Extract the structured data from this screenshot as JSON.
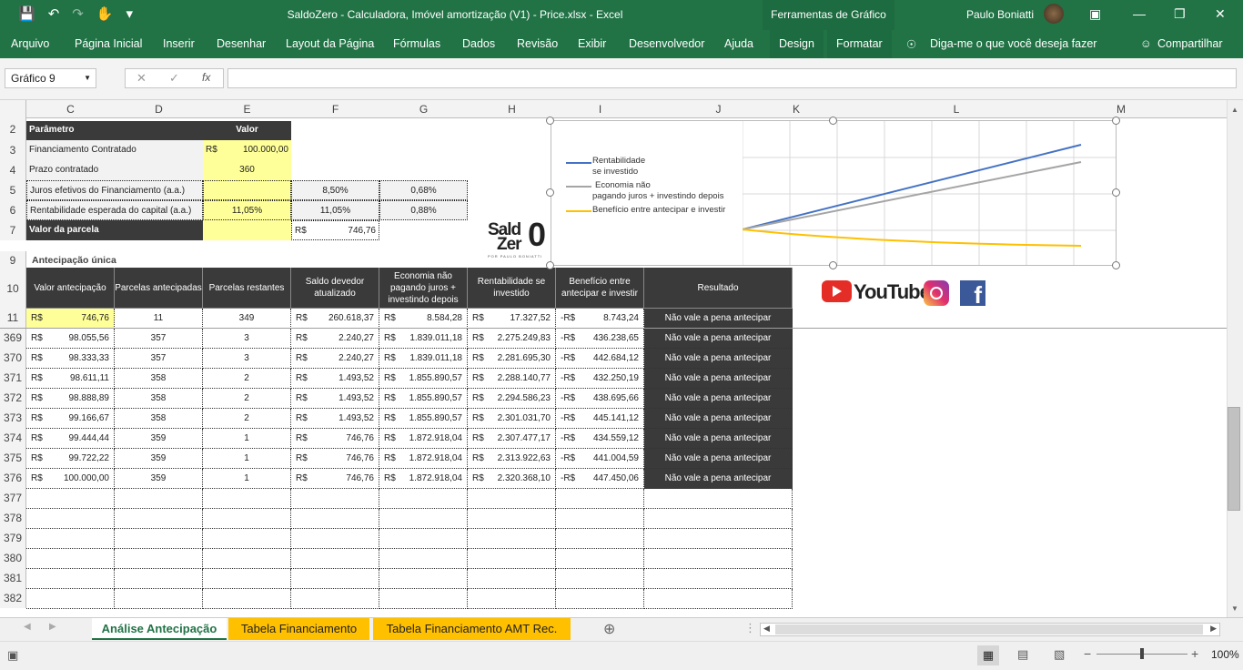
{
  "window": {
    "title": "SaldoZero - Calculadora, Imóvel amortização (V1) - Price.xlsx  -  Excel",
    "context_tab": "Ferramentas de Gráfico",
    "user": "Paulo Boniatti"
  },
  "ribbon": {
    "tabs": [
      "Arquivo",
      "Página Inicial",
      "Inserir",
      "Desenhar",
      "Layout da Página",
      "Fórmulas",
      "Dados",
      "Revisão",
      "Exibir",
      "Desenvolvedor",
      "Ajuda",
      "Design",
      "Formatar"
    ],
    "tell_me": "Diga-me o que você deseja fazer",
    "share": "Compartilhar"
  },
  "formula_bar": {
    "name_box": "Gráfico 9",
    "fx": "fx",
    "value": ""
  },
  "columns": [
    "C",
    "D",
    "E",
    "F",
    "G",
    "H",
    "I",
    "J",
    "K",
    "L",
    "M"
  ],
  "rows": [
    "2",
    "3",
    "4",
    "5",
    "6",
    "7",
    "9",
    "10",
    "11",
    "369",
    "370",
    "371",
    "372",
    "373",
    "374",
    "375",
    "376",
    "377",
    "378",
    "379",
    "380",
    "381",
    "382"
  ],
  "params": {
    "header_param": "Parâmetro",
    "header_value": "Valor",
    "r3_label": "Financiamento Contratado",
    "r3_cur": "R$",
    "r3_val": "100.000,00",
    "r4_label": "Prazo contratado",
    "r4_val": "360",
    "r5_label": "Juros efetivos do Financiamento (a.a.)",
    "r5_f": "8,50%",
    "r5_g": "0,68%",
    "r6_label": "Rentabilidade esperada do capital (a.a.)",
    "r6_e": "11,05%",
    "r6_f": "11,05%",
    "r6_g": "0,88%",
    "r7_label": "Valor da parcela",
    "r7_cur": "R$",
    "r7_val": "746,76"
  },
  "section_title": "Antecipação única",
  "table": {
    "headers": [
      "Valor antecipação",
      "Parcelas antecipadas",
      "Parcelas restantes",
      "Saldo devedor atualizado",
      "Economia não pagando juros + investindo depois",
      "Rentabilidade se investido",
      "Benefício entre antecipar e investir",
      "Resultado"
    ],
    "rows": [
      [
        "R$",
        "746,76",
        "11",
        "349",
        "R$",
        "260.618,37",
        "R$",
        "8.584,28",
        "R$",
        "17.327,52",
        "-R$",
        "8.743,24",
        "Não vale a pena antecipar"
      ],
      [
        "R$",
        "98.055,56",
        "357",
        "3",
        "R$",
        "2.240,27",
        "R$",
        "1.839.011,18",
        "R$",
        "2.275.249,83",
        "-R$",
        "436.238,65",
        "Não vale a pena antecipar"
      ],
      [
        "R$",
        "98.333,33",
        "357",
        "3",
        "R$",
        "2.240,27",
        "R$",
        "1.839.011,18",
        "R$",
        "2.281.695,30",
        "-R$",
        "442.684,12",
        "Não vale a pena antecipar"
      ],
      [
        "R$",
        "98.611,11",
        "358",
        "2",
        "R$",
        "1.493,52",
        "R$",
        "1.855.890,57",
        "R$",
        "2.288.140,77",
        "-R$",
        "432.250,19",
        "Não vale a pena antecipar"
      ],
      [
        "R$",
        "98.888,89",
        "358",
        "2",
        "R$",
        "1.493,52",
        "R$",
        "1.855.890,57",
        "R$",
        "2.294.586,23",
        "-R$",
        "438.695,66",
        "Não vale a pena antecipar"
      ],
      [
        "R$",
        "99.166,67",
        "358",
        "2",
        "R$",
        "1.493,52",
        "R$",
        "1.855.890,57",
        "R$",
        "2.301.031,70",
        "-R$",
        "445.141,12",
        "Não vale a pena antecipar"
      ],
      [
        "R$",
        "99.444,44",
        "359",
        "1",
        "R$",
        "746,76",
        "R$",
        "1.872.918,04",
        "R$",
        "2.307.477,17",
        "-R$",
        "434.559,12",
        "Não vale a pena antecipar"
      ],
      [
        "R$",
        "99.722,22",
        "359",
        "1",
        "R$",
        "746,76",
        "R$",
        "1.872.918,04",
        "R$",
        "2.313.922,63",
        "-R$",
        "441.004,59",
        "Não vale a pena antecipar"
      ],
      [
        "R$",
        "100.000,00",
        "359",
        "1",
        "R$",
        "746,76",
        "R$",
        "1.872.918,04",
        "R$",
        "2.320.368,10",
        "-R$",
        "447.450,06",
        "Não vale a pena antecipar"
      ]
    ]
  },
  "chart": {
    "legend": [
      "Rentabilidade",
      "se investido",
      "Economia não",
      "pagando juros + investindo depois",
      "Benefício entre antecipar e investir"
    ],
    "colors": [
      "#4472c4",
      "#a5a5a5",
      "#ffc000"
    ]
  },
  "logo": {
    "line1": "Sald",
    "line2": "Zer",
    "big": "0",
    "tag": "POR PAULO BONIATTI"
  },
  "social": {
    "youtube": "YouTube"
  },
  "sheets": [
    "Análise Antecipação",
    "Tabela Financiamento",
    "Tabela Financiamento AMT Rec."
  ],
  "status": {
    "zoom": "100%"
  }
}
